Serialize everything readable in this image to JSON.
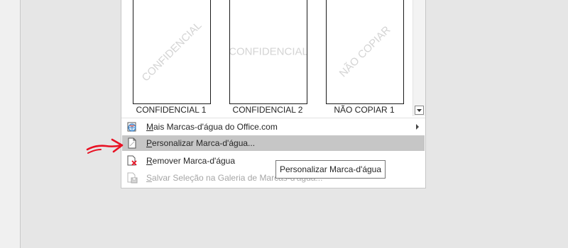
{
  "gallery": {
    "items": [
      {
        "watermark": "CONFIDENCIAL",
        "caption": "CONFIDENCIAL 1",
        "orientation": "diagonal"
      },
      {
        "watermark": "CONFIDENCIAL",
        "caption": "CONFIDENCIAL 2",
        "orientation": "horizontal"
      },
      {
        "watermark": "NÃO COPIAR",
        "caption": "NÃO COPIAR 1",
        "orientation": "diagonal"
      }
    ]
  },
  "menu": {
    "items": [
      {
        "accel": "M",
        "rest": "ais Marcas-d'água do Office.com",
        "icon": "office-globe-icon",
        "submenu": true
      },
      {
        "accel": "P",
        "rest": "ersonalizar Marca-d'água...",
        "icon": "document-icon",
        "highlighted": true
      },
      {
        "accel": "R",
        "rest": "emover Marca-d'água",
        "icon": "remove-document-icon"
      },
      {
        "accel": "S",
        "rest": "alvar Seleção na Galeria de Marcas-d'água...",
        "icon": "save-to-gallery-icon",
        "disabled": true
      }
    ]
  },
  "tooltip": {
    "text": "Personalizar Marca-d'água"
  },
  "colors": {
    "highlight": "#c6c6c6",
    "annotation_arrow": "#e81123",
    "disabled_text": "#a6a6a6"
  }
}
